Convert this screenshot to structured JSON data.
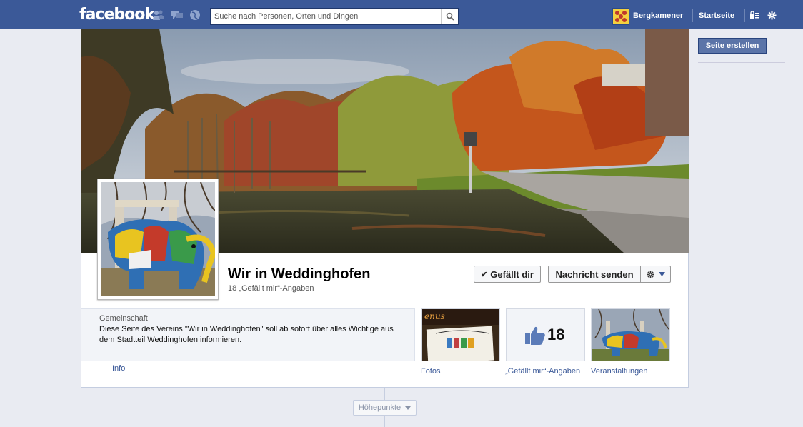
{
  "topbar": {
    "logo": "facebook",
    "search_placeholder": "Suche nach Personen, Orten und Dingen",
    "user_name": "Bergkamener",
    "home_label": "Startseite"
  },
  "sidebar": {
    "create_page_label": "Seite erstellen"
  },
  "page": {
    "title": "Wir in Weddinghofen",
    "likes_text": "18 „Gefällt mir“-Angaben",
    "like_button": "Gefällt dir",
    "like_check": "✔",
    "message_button": "Nachricht senden",
    "category": "Gemeinschaft",
    "description": "Diese Seite des Vereins \"Wir in Weddinghofen\" soll ab sofort über alles Wichtige aus dem Stadtteil Weddinghofen informieren.",
    "info_link": "Info"
  },
  "tiles": {
    "photos_label": "Fotos",
    "likes_label": "„Gefällt mir“-Angaben",
    "likes_number": "18",
    "events_label": "Veranstaltungen"
  },
  "timeline": {
    "highlights_label": "Höhepunkte"
  },
  "icons": {
    "friends": "friends-icon",
    "messages": "messages-icon",
    "notifications": "globe-icon",
    "search": "search-icon",
    "privacy": "privacy-icon",
    "settings": "gear-icon",
    "thumb": "thumbs-up-icon"
  },
  "colors": {
    "brand": "#3b5998",
    "page_bg": "#e9ebf2"
  }
}
